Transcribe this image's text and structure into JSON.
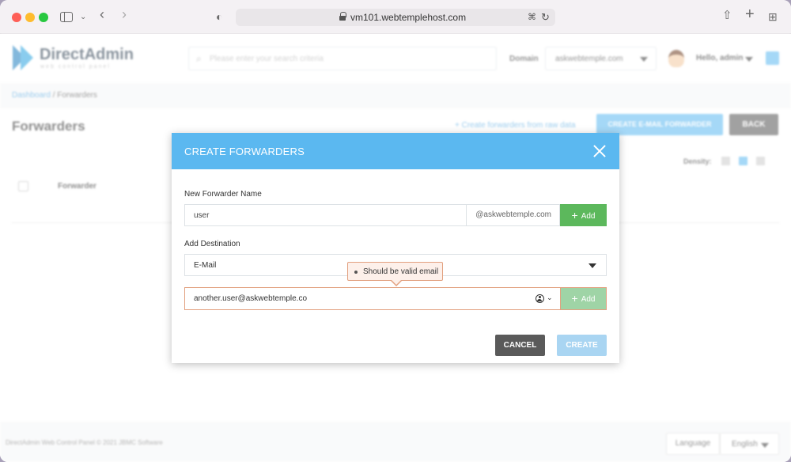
{
  "browser": {
    "url": "vm101.webtemplehost.com"
  },
  "header": {
    "logo": "DirectAdmin",
    "logo_sub": "web control panel",
    "search_placeholder": "Please enter your search criteria",
    "domain_label": "Domain",
    "domain_value": "askwebtemple.com",
    "greeting": "Hello, admin"
  },
  "breadcrumb": {
    "home": "Dashboard",
    "separator": " / ",
    "current": "Forwarders"
  },
  "page": {
    "title": "Forwarders",
    "raw_link": "+ Create forwarders from raw data",
    "create_email_button": "CREATE E-MAIL FORWARDER",
    "back_button": "BACK",
    "density_label": "Density:",
    "table_column": "Forwarder"
  },
  "footer": {
    "copyright": "DirectAdmin Web Control Panel © 2021 JBMC Software",
    "language_label": "Language",
    "language_value": "English"
  },
  "modal": {
    "title": "CREATE FORWARDERS",
    "name_label": "New Forwarder Name",
    "name_value": "user",
    "domain_suffix": "@askwebtemple.com",
    "add_label": "Add",
    "destination_label": "Add Destination",
    "destination_type": "E-Mail",
    "tooltip": "Should be valid email",
    "email_value": "another.user@askwebtemple.co",
    "cancel_label": "CANCEL",
    "create_label": "CREATE"
  },
  "colors": {
    "accent": "#5bb8f0",
    "success": "#5cb85c",
    "error_border": "#e2a07f"
  }
}
